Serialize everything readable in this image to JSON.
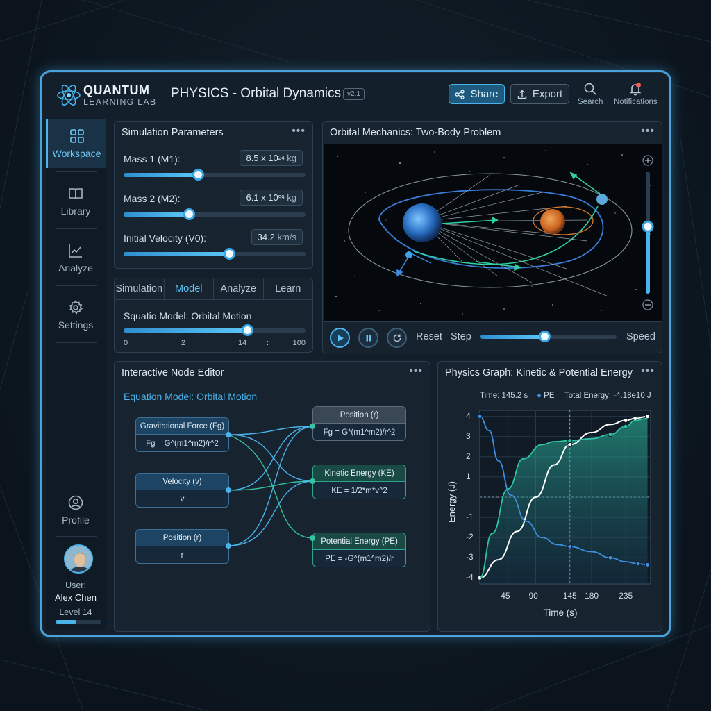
{
  "header": {
    "brand_line1": "QUANTUM",
    "brand_line2": "LEARNING LAB",
    "title": "PHYSICS - Orbital Dynamics",
    "version": "v2.1",
    "share_label": "Share",
    "export_label": "Export",
    "search_label": "Search",
    "notifications_label": "Notifications"
  },
  "sidebar": {
    "items": [
      {
        "label": "Workspace",
        "icon": "grid-icon",
        "active": true
      },
      {
        "label": "Library",
        "icon": "book-icon"
      },
      {
        "label": "Analyze",
        "icon": "chart-icon"
      },
      {
        "label": "Settings",
        "icon": "gear-icon"
      }
    ],
    "profile_label": "Profile",
    "user_label": "User:",
    "user_name": "Alex Chen",
    "level": "Level 14",
    "level_progress": 0.45
  },
  "params": {
    "title": "Simulation Parameters",
    "mass1": {
      "label": "Mass 1 (M1):",
      "value_num": "8.5 x 10",
      "exp": "24",
      "unit": "kg",
      "fraction": 0.41
    },
    "mass2": {
      "label": "Mass 2 (M2):",
      "value_num": "6.1 x 10",
      "exp": "99",
      "unit": "kg",
      "fraction": 0.36
    },
    "velocity": {
      "label": "Initial Velocity (V0):",
      "value_num": "34.2",
      "unit": "km/s",
      "fraction": 0.58
    }
  },
  "model": {
    "tabs": [
      "Simulation",
      "Model",
      "Analyze",
      "Learn"
    ],
    "active_tab": "Model",
    "name": "Squatio Model: Orbital Motion",
    "slider_fraction": 0.68,
    "ticks": [
      "0",
      ":",
      "2",
      ":",
      "14",
      ":",
      "100"
    ]
  },
  "orbital": {
    "title": "Orbital Mechanics: Two-Body Problem",
    "reset_label": "Reset",
    "step_label": "Step",
    "speed_label": "Speed",
    "speed_fraction": 0.47,
    "zoom_fraction": 0.55
  },
  "nodes": {
    "title": "Interactive Node Editor",
    "subtitle": "Equation Model: Orbital Motion",
    "items": [
      {
        "title": "Gravitational Force (Fg)",
        "body": "Fg = G^(m1^m2)/r^2"
      },
      {
        "title": "Velocity (v)",
        "body": "v"
      },
      {
        "title": "Position (r)",
        "body": "r"
      },
      {
        "title": "Position (r)",
        "body": "Fg = G*(m1^m2)/r^2"
      },
      {
        "title": "Kinetic Energy (KE)",
        "body": "KE = 1/2*m*v^2"
      },
      {
        "title": "Potential Energy (PE)",
        "body": "PE = -G^(m1^m2)/r"
      }
    ]
  },
  "graph": {
    "title": "Physics Graph: Kinetic & Potential Energy",
    "time_label": "Time: 145.2 s",
    "pe_label": "PE",
    "total_label": "Total Energy: -4.18e10 J",
    "ylabel": "Energy (J)",
    "xlabel": "Time (s)",
    "y_ticks": [
      "4",
      "3",
      "2",
      "1",
      "-1",
      "-2",
      "-3",
      "-4"
    ],
    "x_ticks": [
      "45",
      "90",
      "145",
      "180",
      "235"
    ]
  },
  "chart_data": {
    "type": "line",
    "xlabel": "Time (s)",
    "ylabel": "Energy (J)",
    "xlim": [
      0,
      275
    ],
    "ylim": [
      -4.3,
      4.3
    ],
    "series": [
      {
        "name": "",
        "color": "#ffffff",
        "x": [
          0,
          30,
          60,
          90,
          120,
          145,
          180,
          210,
          235,
          250,
          270
        ],
        "y": [
          -4,
          -3.1,
          -1.7,
          0,
          1.6,
          2.6,
          3.2,
          3.6,
          3.8,
          3.9,
          4.0
        ]
      },
      {
        "name": "",
        "color": "#2ec4a6",
        "x": [
          0,
          20,
          45,
          70,
          100,
          120,
          145,
          180,
          210,
          235,
          250,
          270
        ],
        "y": [
          -4,
          -1.8,
          0.4,
          1.9,
          2.6,
          2.75,
          2.8,
          2.9,
          3.1,
          3.5,
          3.8,
          3.9
        ]
      },
      {
        "name": "PE",
        "color": "#3d8fe0",
        "x": [
          0,
          15,
          30,
          50,
          75,
          100,
          125,
          145,
          180,
          210,
          235,
          255,
          270
        ],
        "y": [
          4,
          3.3,
          1.8,
          0.1,
          -1.2,
          -2.0,
          -2.35,
          -2.45,
          -2.7,
          -3.0,
          -3.2,
          -3.3,
          -3.35
        ]
      }
    ]
  },
  "colors": {
    "accent": "#4ab3ec",
    "green": "#2ec4a6",
    "bg": "#131f2a"
  }
}
